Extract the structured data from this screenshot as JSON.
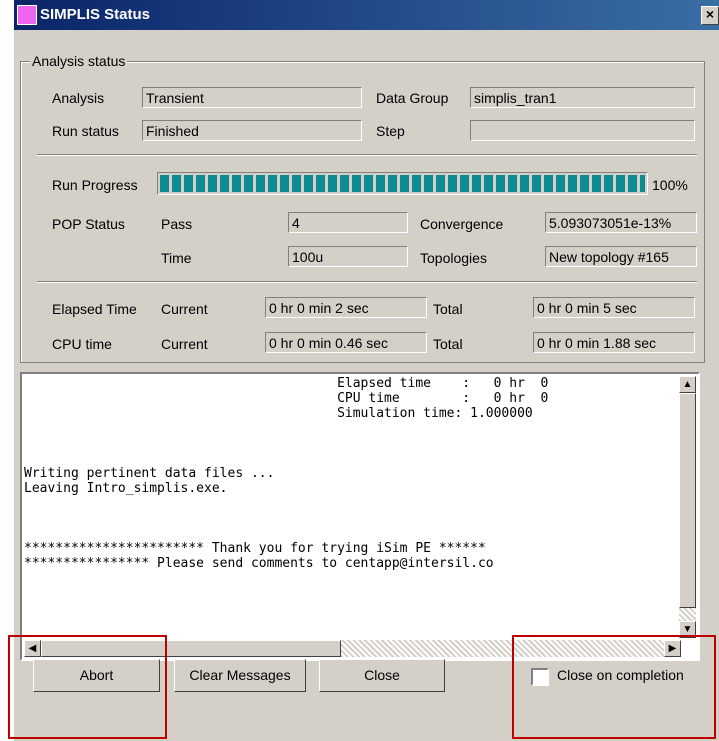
{
  "window": {
    "title": "SIMPLIS Status",
    "close_glyph": "×"
  },
  "group": {
    "legend": "Analysis status"
  },
  "analysis": {
    "label": "Analysis",
    "value": "Transient"
  },
  "data_group": {
    "label": "Data Group",
    "value": "simplis_tran1"
  },
  "run_status": {
    "label": "Run status",
    "value": "Finished"
  },
  "step": {
    "label": "Step",
    "value": ""
  },
  "run_progress": {
    "label": "Run Progress",
    "percent_text": "100%",
    "fraction": 1.0
  },
  "pop": {
    "label": "POP Status",
    "pass_label": "Pass",
    "pass_value": "4",
    "time_label": "Time",
    "time_value": "100u",
    "convergence_label": "Convergence",
    "convergence_value": "5.093073051e-13%",
    "topologies_label": "Topologies",
    "topologies_value": "New topology #165"
  },
  "elapsed": {
    "label": "Elapsed Time",
    "current_label": "Current",
    "current_value": "0 hr  0 min  2   sec",
    "total_label": "Total",
    "total_value": "0 hr  0 min  5   sec"
  },
  "cpu": {
    "label": "CPU time",
    "current_label": "Current",
    "current_value": "0 hr  0 min  0.46 sec",
    "total_label": "Total",
    "total_value": "0 hr  0 min  1.88 sec"
  },
  "console": {
    "lines": [
      "                                        Elapsed time    :   0 hr  0",
      "                                        CPU time        :   0 hr  0",
      "                                        Simulation time: 1.000000",
      "",
      "",
      "",
      "Writing pertinent data files ...",
      "Leaving Intro_simplis.exe.",
      "",
      "",
      "",
      "*********************** Thank you for trying iSim PE ******",
      "**************** Please send comments to centapp@intersil.co"
    ]
  },
  "buttons": {
    "abort": "Abort",
    "clear": "Clear Messages",
    "close": "Close"
  },
  "close_on_completion": {
    "label": "Close on completion",
    "checked": false
  },
  "highlight_color": "#c00000"
}
